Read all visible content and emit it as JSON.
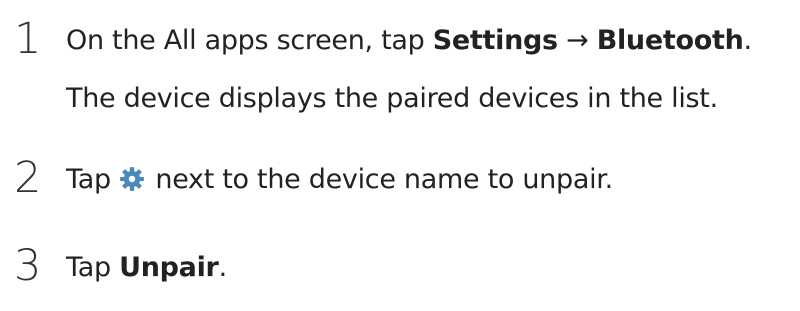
{
  "steps": [
    {
      "number": "1",
      "line1": {
        "prefix": "On the All apps screen, tap ",
        "bold1": "Settings",
        "arrow": " → ",
        "bold2": "Bluetooth",
        "suffix": "."
      },
      "line2": "The device displays the paired devices in the list."
    },
    {
      "number": "2",
      "before_icon": "Tap ",
      "icon": "gear-icon",
      "after_icon": " next to the device name to unpair."
    },
    {
      "number": "3",
      "prefix": "Tap ",
      "bold": "Unpair",
      "suffix": "."
    }
  ],
  "colors": {
    "icon": "#4a8ab8",
    "text": "#222222"
  }
}
